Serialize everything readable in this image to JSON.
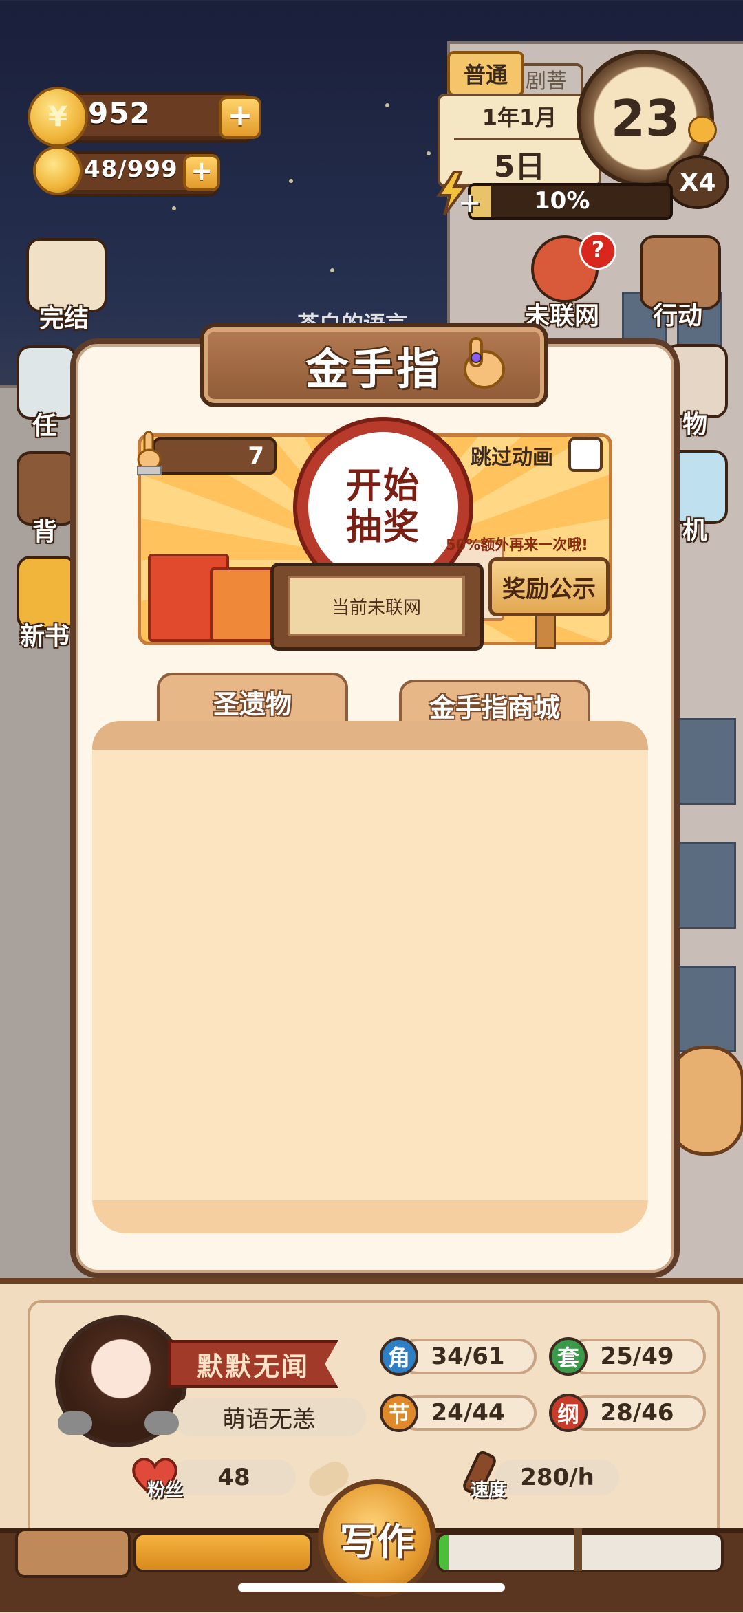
{
  "currency": {
    "coins": "952",
    "coin_symbol": "¥",
    "energy": "48/999",
    "plus": "+"
  },
  "calendar": {
    "mode": "普通",
    "behind_tab": "剧菩",
    "year_month": "1年1月",
    "day": "5日",
    "clock_value": "23",
    "speed": "X4",
    "progress_text": "10%",
    "progress": 0.1,
    "energy_plus": "+"
  },
  "side_left": [
    {
      "label": "完结"
    },
    {
      "label": "任"
    },
    {
      "label": "背"
    },
    {
      "label": "新书"
    }
  ],
  "side_right": [
    {
      "label": "未联网",
      "badge": "?"
    },
    {
      "label": "行动"
    },
    {
      "label": "物"
    },
    {
      "label": "机"
    }
  ],
  "bg_text": "茶白的语言",
  "modal": {
    "title": "金手指",
    "finger_count": "7",
    "skip_animation": "跳过动画",
    "draw_line1": "开始",
    "draw_line2": "抽奖",
    "bonus": "50%额外再来一次哦!",
    "reward_button": "奖励公示",
    "current_status": "当前未联网",
    "tabs": [
      "圣遗物",
      "金手指商城"
    ]
  },
  "profile": {
    "name": "默默无闻",
    "motto": "萌语无恙",
    "fans_label": "粉丝",
    "fans": "48",
    "speed_label": "速度",
    "speed": "280/h",
    "stats": [
      {
        "icon": "角",
        "value": "34/61",
        "color": "#2e7fc4"
      },
      {
        "icon": "套",
        "value": "25/49",
        "color": "#3a9a4a"
      },
      {
        "icon": "节",
        "value": "24/44",
        "color": "#e0892a"
      },
      {
        "icon": "纲",
        "value": "28/46",
        "color": "#c83a2a"
      }
    ]
  },
  "bottom": {
    "write": "写作"
  }
}
